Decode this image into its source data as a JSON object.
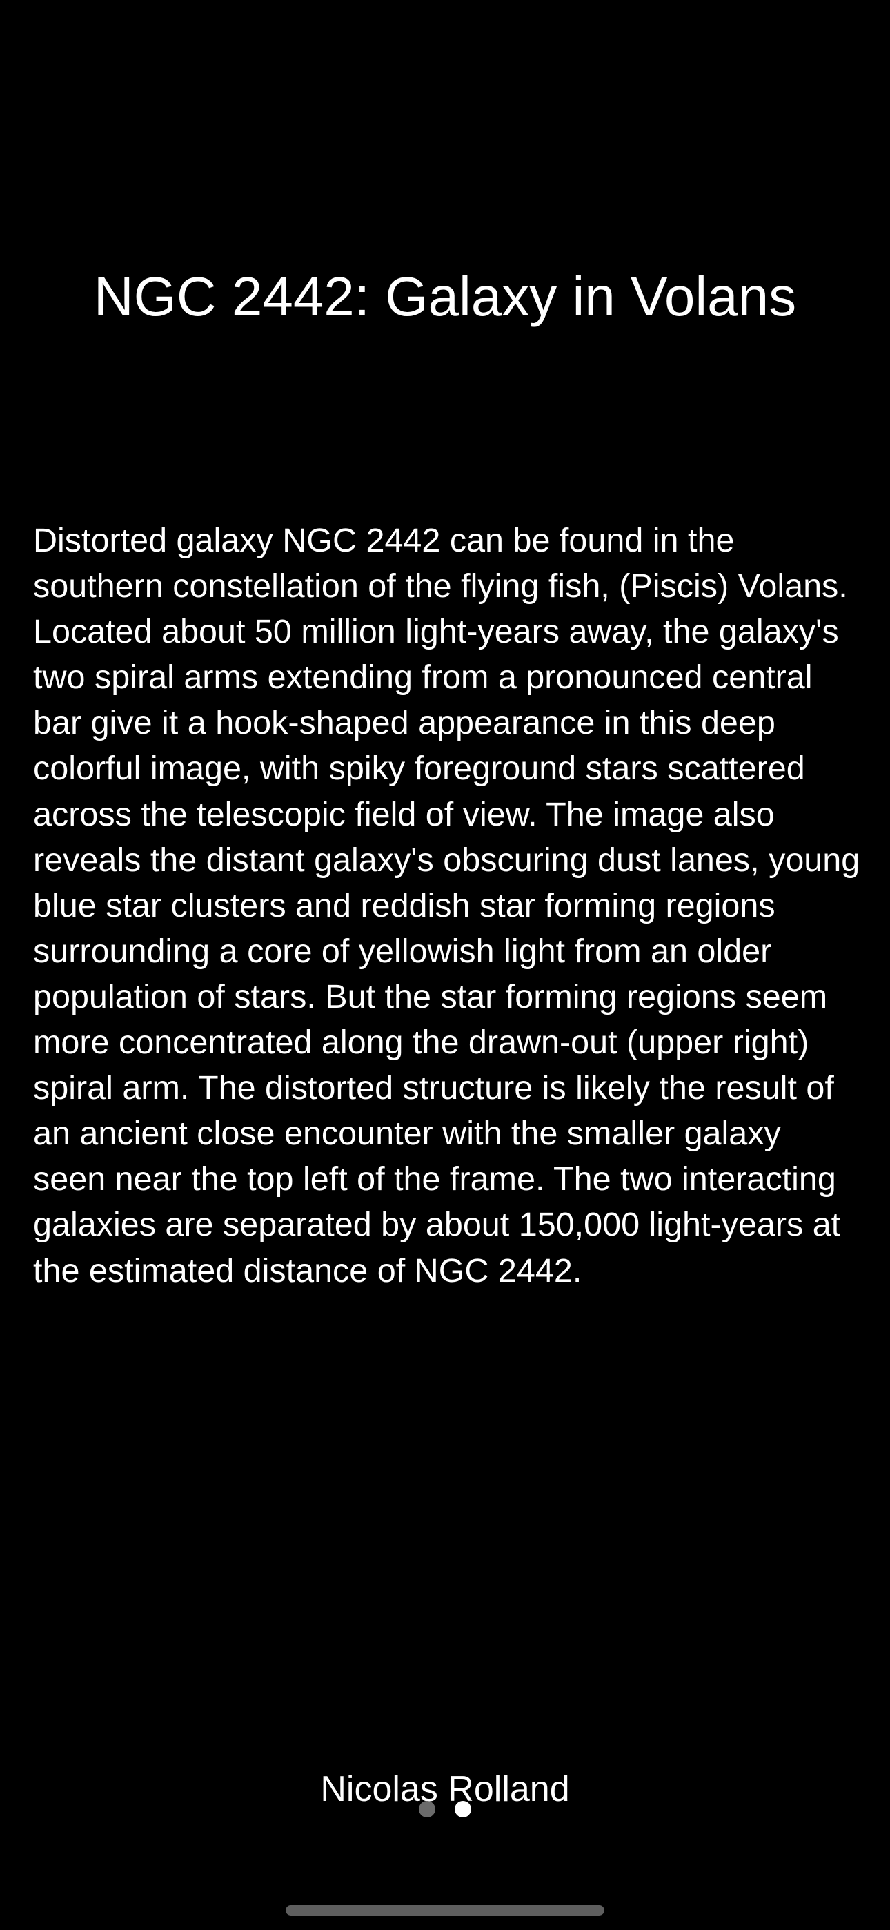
{
  "title": "NGC 2442: Galaxy in Volans",
  "description": "Distorted galaxy NGC 2442 can be found in the southern constellation of the flying fish, (Piscis) Volans. Located about 50 million light-years away, the galaxy's two spiral arms extending from a pronounced central bar give it a hook-shaped appearance in this deep colorful image, with spiky foreground stars scattered across the telescopic field of view. The image also reveals the distant galaxy's obscuring dust lanes, young blue star clusters and reddish star forming regions surrounding a core of yellowish light from an older population of stars. But the star forming regions seem more concentrated along the drawn-out (upper right) spiral arm. The distorted structure is likely the result of an ancient close encounter with the smaller galaxy seen near the top left of the frame. The two interacting galaxies are separated by about 150,000 light-years at the estimated distance of NGC 2442.",
  "credit": "Nicolas Rolland",
  "pager": {
    "page_count": 2,
    "current_page": 2
  },
  "colors": {
    "background": "#000000",
    "text": "#ffffff",
    "dot_inactive": "#6b6b6b",
    "dot_active": "#ffffff"
  }
}
